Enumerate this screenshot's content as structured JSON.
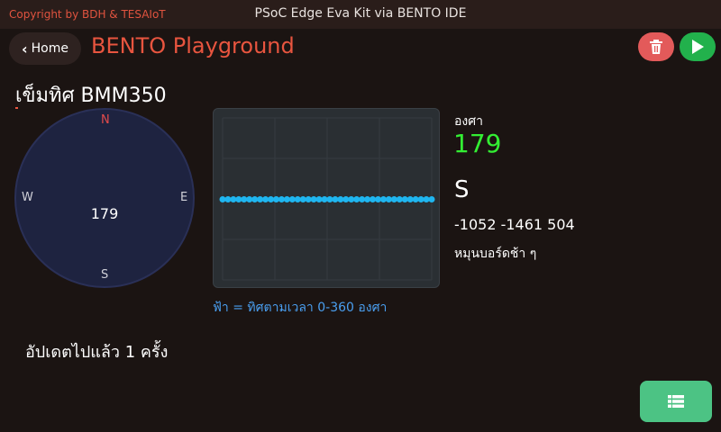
{
  "header": {
    "copyright": "Copyright by BDH & TESAIoT",
    "window_title": "PSoC Edge Eva Kit via BENTO IDE"
  },
  "toolbar": {
    "home_label": "Home",
    "app_title": "BENTO Playground",
    "delete_icon": "trash-icon",
    "run_icon": "play-icon"
  },
  "sensor": {
    "title": "เข็มทิศ BMM350"
  },
  "compass": {
    "north": "N",
    "south": "S",
    "west": "W",
    "east": "E",
    "heading": "179"
  },
  "chart_data": {
    "type": "line",
    "title": "",
    "caption": "ฟ้า = ทิศตามเวลา 0-360 องศา",
    "ylim": [
      0,
      360
    ],
    "grid": true,
    "series": [
      {
        "color": "#1fb6f0",
        "values": [
          179,
          179,
          179,
          179,
          179,
          179,
          179,
          179,
          179,
          179,
          179,
          179,
          179,
          179,
          179,
          179,
          179,
          179,
          179,
          179,
          179,
          179,
          179,
          179,
          179,
          179,
          179,
          179,
          179,
          179,
          179,
          179,
          179,
          179,
          179,
          179,
          179,
          179,
          179,
          179
        ]
      }
    ]
  },
  "readout": {
    "degree_label": "องศา",
    "degree_value": "179",
    "direction": "S",
    "raw_xyz": "-1052 -1461 504",
    "hint": "หมุนบอร์ดช้า ๆ"
  },
  "status": {
    "update_count": "อัปเดตไปแล้ว 1 ครั้ง"
  },
  "footer": {
    "list_icon": "list-icon"
  },
  "colors": {
    "accent": "#e8553f",
    "heading_value": "#33ee33",
    "series_line": "#1fb6f0",
    "delete": "#e35a5a",
    "run": "#22b14c",
    "list_button": "#4cc384"
  }
}
